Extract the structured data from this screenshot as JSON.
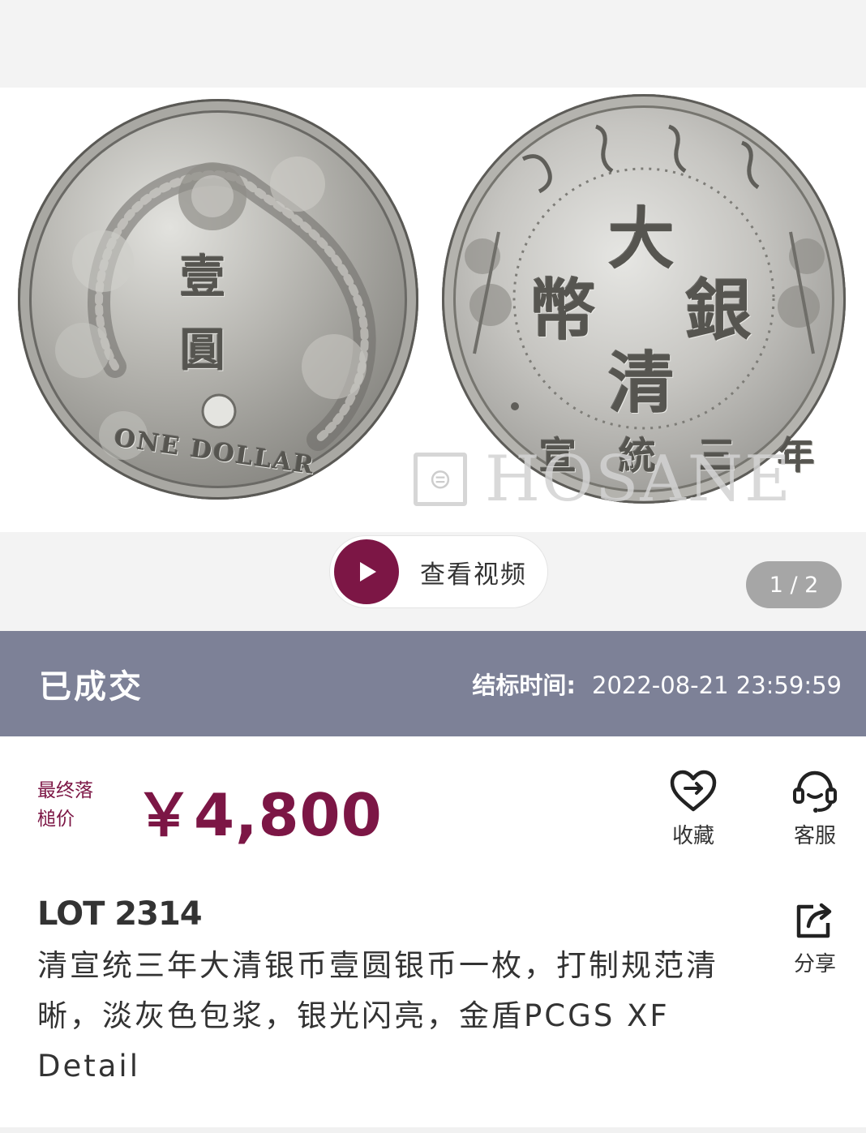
{
  "gallery": {
    "obverse_chars": [
      "壹",
      "圓"
    ],
    "obverse_legend": "ONE DOLLAR",
    "reverse_chars": [
      "大",
      "銀",
      "清",
      "幣"
    ],
    "reverse_bottom": "宣 統 三 年",
    "watermark_symbol": "⊜",
    "watermark_text": "HOSANE",
    "video_label": "查看视频",
    "pager": "1 / 2"
  },
  "status": {
    "text": "已成交",
    "end_time_label": "结标时间:",
    "end_time_value": "2022-08-21 23:59:59"
  },
  "price": {
    "label": "最终落槌价",
    "value": "￥4,800"
  },
  "actions": {
    "favorite_label": "收藏",
    "service_label": "客服",
    "share_label": "分享"
  },
  "lot": {
    "number": "LOT 2314",
    "description": "清宣统三年大清银币壹圆银币一枚，打制规范清晰，淡灰色包浆，银光闪亮，金盾PCGS XF Detail"
  },
  "colors": {
    "accent": "#7c1645",
    "status_bar": "#7d8197",
    "pager_bg": "#a6a6a6"
  }
}
